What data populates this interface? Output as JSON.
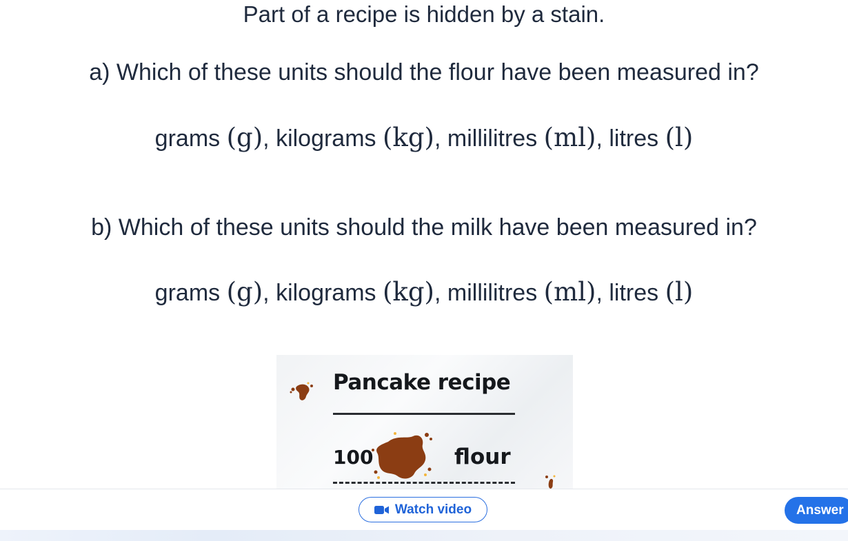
{
  "intro": "Part of a recipe is hidden by a stain.",
  "question_a": "a) Which of these units should the flour have been measured in?",
  "question_b": "b) Which of these units should the milk have been measured in?",
  "options": {
    "sep": ", ",
    "grams_word": "grams ",
    "grams_unit": "(g)",
    "kilograms_word": "kilograms ",
    "kilograms_unit": "(kg)",
    "millilitres_word": "millilitres ",
    "millilitres_unit": "(ml)",
    "litres_word": "litres ",
    "litres_unit": "(l)"
  },
  "recipe_card": {
    "title": "Pancake recipe",
    "amount": "100",
    "ingredient": "flour"
  },
  "footer": {
    "watch_video_label": "Watch video",
    "answer_label": "Answer",
    "video_icon": "video-camera-icon"
  },
  "colors": {
    "accent": "#2472e8",
    "stain": "#8b3d13",
    "text": "#1f2a3d"
  }
}
